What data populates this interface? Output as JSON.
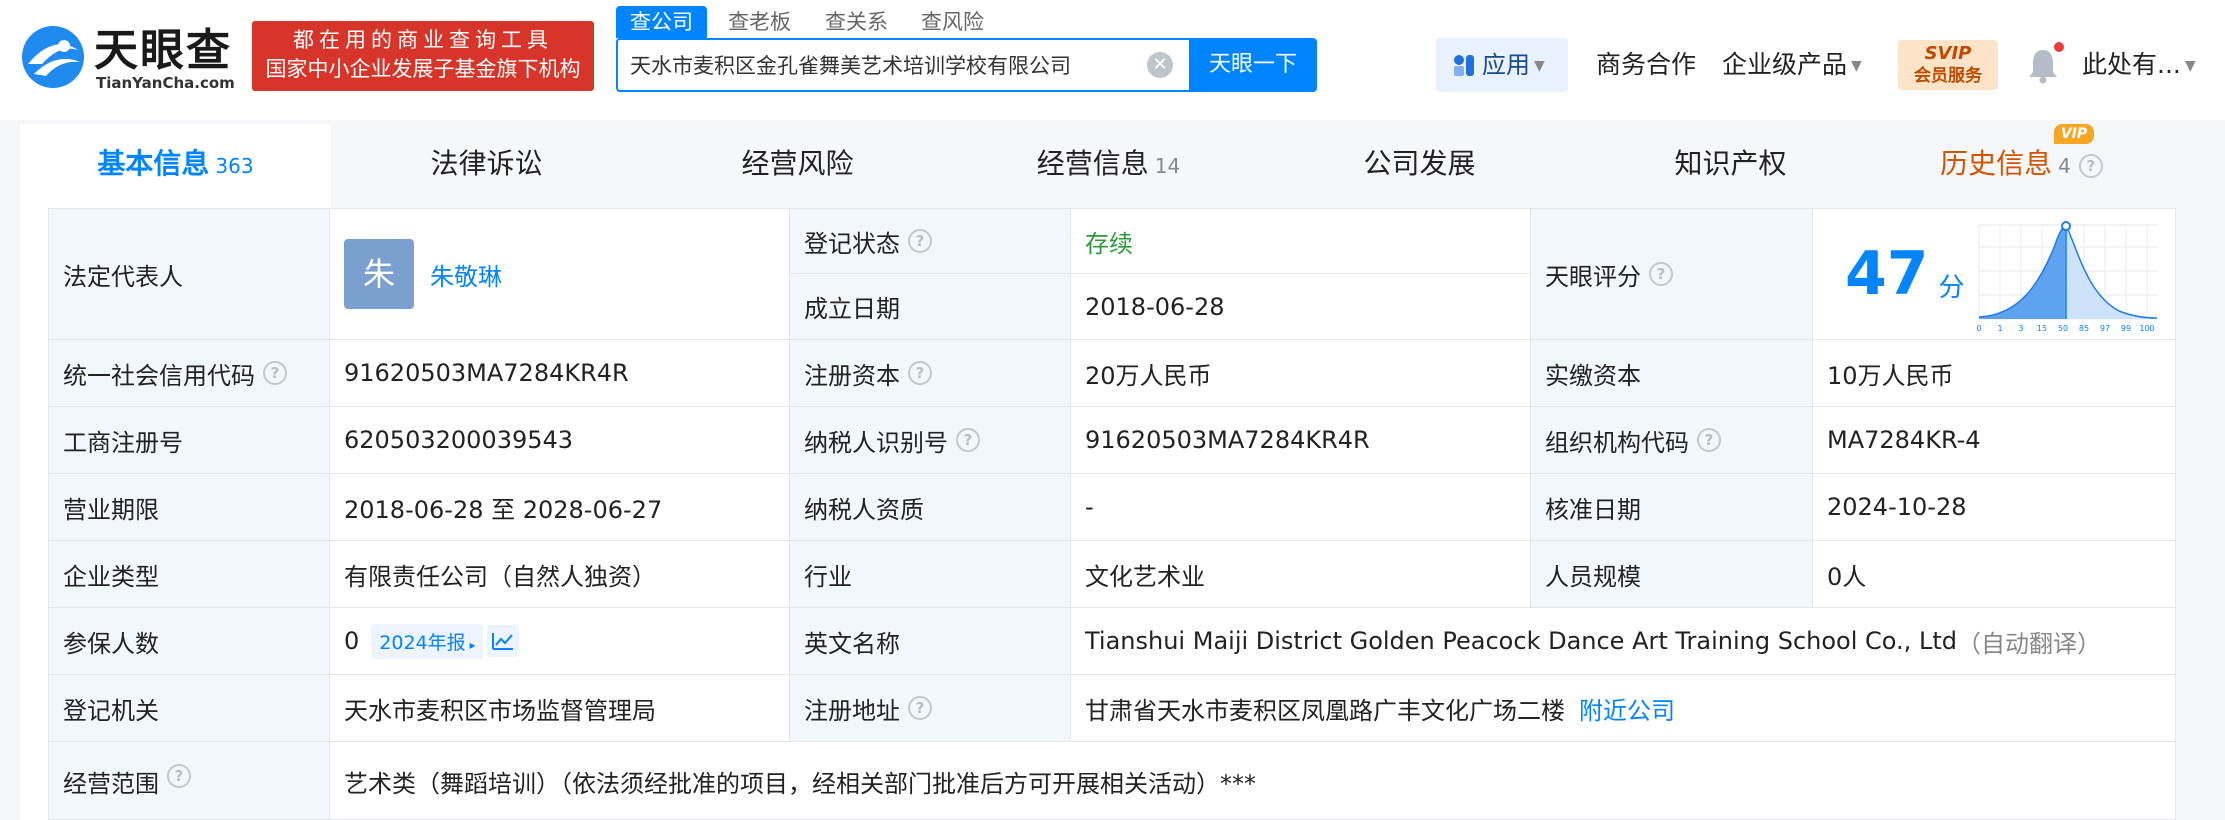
{
  "logo": {
    "name": "天眼查",
    "domain": "TianYanCha.com"
  },
  "slogan": {
    "line1": "都在用的商业查询工具",
    "line2": "国家中小企业发展子基金旗下机构"
  },
  "search": {
    "tabs": [
      "查公司",
      "查老板",
      "查关系",
      "查风险"
    ],
    "value": "天水市麦积区金孔雀舞美艺术培训学校有限公司",
    "button": "天眼一下"
  },
  "nav": {
    "app": "应用",
    "business": "商务合作",
    "enterprise": "企业级产品",
    "svip_line1": "SVIP",
    "svip_line2": "会员服务",
    "user": "此处有..."
  },
  "tabs": [
    {
      "label": "基本信息",
      "count": "363"
    },
    {
      "label": "法律诉讼",
      "count": ""
    },
    {
      "label": "经营风险",
      "count": ""
    },
    {
      "label": "经营信息",
      "count": "14"
    },
    {
      "label": "公司发展",
      "count": ""
    },
    {
      "label": "知识产权",
      "count": ""
    },
    {
      "label": "历史信息",
      "count": "4"
    }
  ],
  "vip_badge": "VIP",
  "info": {
    "legal_rep_label": "法定代表人",
    "legal_rep_avatar": "朱",
    "legal_rep": "朱敬琳",
    "reg_status_label": "登记状态",
    "reg_status": "存续",
    "found_date_label": "成立日期",
    "found_date": "2018-06-28",
    "score_label": "天眼评分",
    "score": "47",
    "score_unit": "分",
    "score_axis": [
      "0",
      "1",
      "3",
      "15",
      "50",
      "85",
      "97",
      "99",
      "100"
    ],
    "credit_code_label": "统一社会信用代码",
    "credit_code": "91620503MA7284KR4R",
    "reg_capital_label": "注册资本",
    "reg_capital": "20万人民币",
    "paid_capital_label": "实缴资本",
    "paid_capital": "10万人民币",
    "biz_reg_no_label": "工商注册号",
    "biz_reg_no": "620503200039543",
    "taxpayer_id_label": "纳税人识别号",
    "taxpayer_id": "91620503MA7284KR4R",
    "org_code_label": "组织机构代码",
    "org_code": "MA7284KR-4",
    "term_label": "营业期限",
    "term": "2018-06-28 至 2028-06-27",
    "taxpayer_qual_label": "纳税人资质",
    "taxpayer_qual": "-",
    "approve_date_label": "核准日期",
    "approve_date": "2024-10-28",
    "type_label": "企业类型",
    "type": "有限责任公司（自然人独资）",
    "industry_label": "行业",
    "industry": "文化艺术业",
    "staff_label": "人员规模",
    "staff": "0人",
    "insured_label": "参保人数",
    "insured": "0",
    "insured_report": "2024年报",
    "en_name_label": "英文名称",
    "en_name": "Tianshui Maiji District Golden Peacock Dance Art Training School Co., Ltd",
    "en_name_note": "（自动翻译）",
    "authority_label": "登记机关",
    "authority": "天水市麦积区市场监督管理局",
    "address_label": "注册地址",
    "address": "甘肃省天水市麦积区凤凰路广丰文化广场二楼",
    "nearby": "附近公司",
    "scope_label": "经营范围",
    "scope": "艺术类（舞蹈培训）（依法须经批准的项目，经相关部门批准后方可开展相关活动）***"
  }
}
